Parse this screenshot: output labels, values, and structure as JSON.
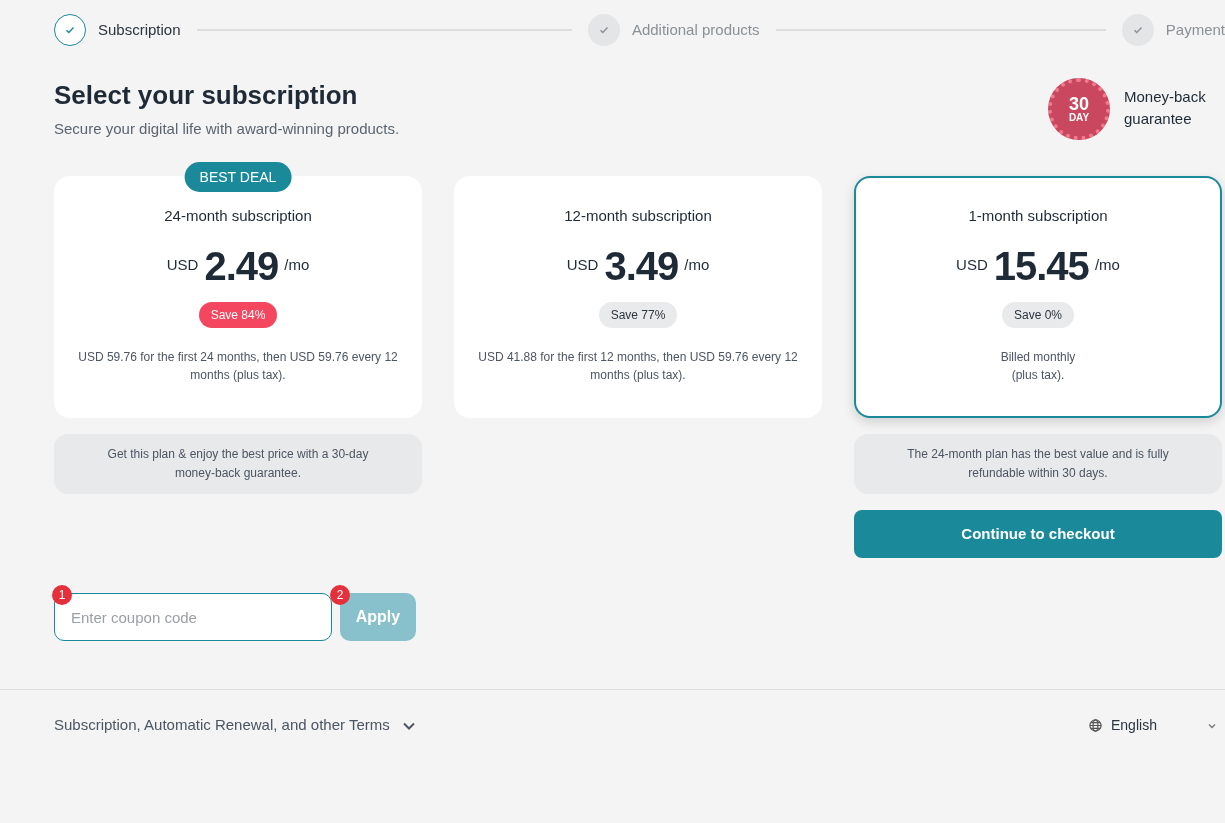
{
  "steps": [
    {
      "label": "Subscription",
      "active": true
    },
    {
      "label": "Additional products",
      "active": false
    },
    {
      "label": "Payment",
      "active": false
    }
  ],
  "heading": {
    "title": "Select your subscription",
    "subtitle": "Secure your digital life with award-winning products."
  },
  "guarantee": {
    "seal_number": "30",
    "seal_unit": "DAY",
    "label": "Money-back guarantee"
  },
  "plans": [
    {
      "badge": "BEST DEAL",
      "name": "24-month subscription",
      "currency": "USD",
      "price": "2.49",
      "unit": "/mo",
      "save": "Save 84%",
      "save_highlight": true,
      "details": "USD 59.76 for the first 24 months, then USD 59.76 every 12 months (plus tax).",
      "selected": false,
      "note": "Get this plan & enjoy the best price with a 30-day money-back guarantee."
    },
    {
      "name": "12-month subscription",
      "currency": "USD",
      "price": "3.49",
      "unit": "/mo",
      "save": "Save 77%",
      "save_highlight": false,
      "details": "USD 41.88 for the first 12 months, then USD 59.76 every 12 months (plus tax).",
      "selected": false
    },
    {
      "name": "1-month subscription",
      "currency": "USD",
      "price": "15.45",
      "unit": "/mo",
      "save": "Save 0%",
      "save_highlight": false,
      "details": "Billed monthly\n(plus tax).",
      "selected": true,
      "note": "The 24-month plan has the best value and is fully refundable within 30 days.",
      "action": "Continue to checkout"
    }
  ],
  "coupon": {
    "placeholder": "Enter coupon code",
    "marker": "1",
    "button": "Apply",
    "button_marker": "2",
    "disabled": true
  },
  "footer": {
    "terms": "Subscription, Automatic Renewal, and other Terms",
    "language": "English"
  }
}
